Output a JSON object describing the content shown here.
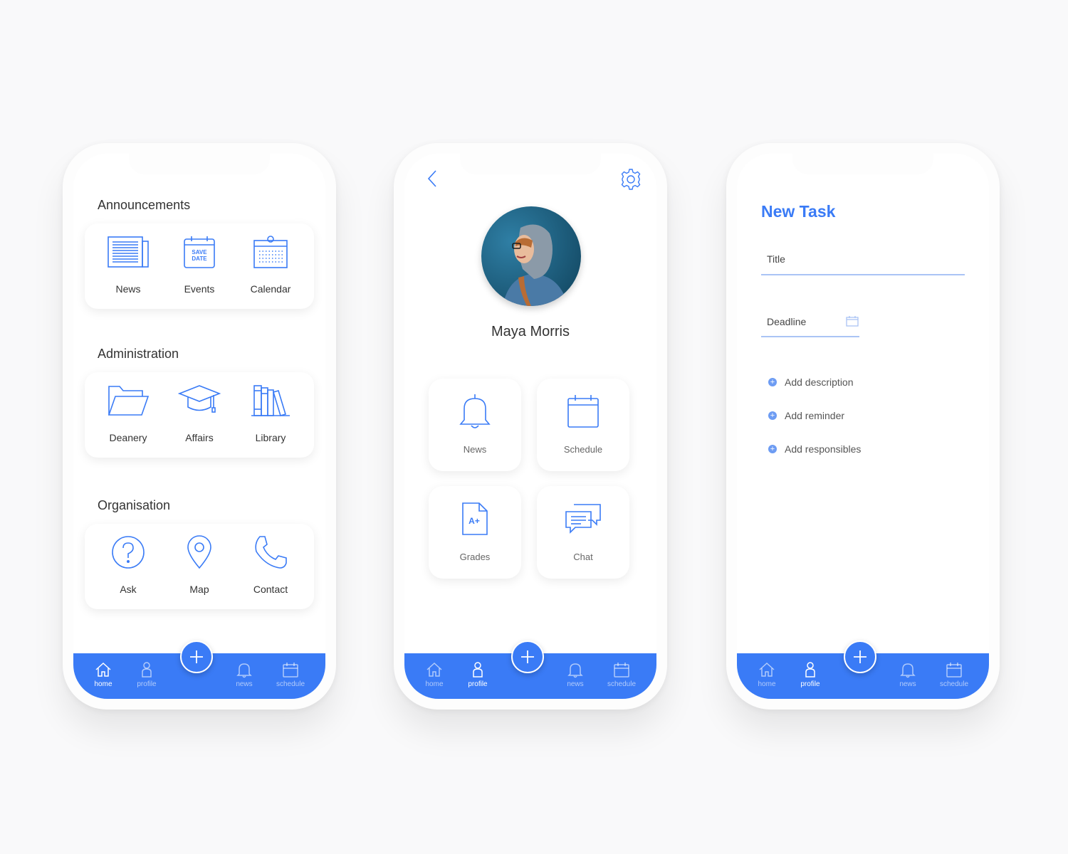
{
  "colors": {
    "accent": "#3a7bf6",
    "background": "#f9f9fa",
    "card": "#ffffff"
  },
  "home_screen": {
    "sections": [
      {
        "title": "Announcements",
        "items": [
          {
            "label": "News",
            "icon": "newspaper-icon"
          },
          {
            "label": "Events",
            "icon": "save-the-date-icon"
          },
          {
            "label": "Calendar",
            "icon": "calendar-icon"
          }
        ]
      },
      {
        "title": "Administration",
        "items": [
          {
            "label": "Deanery",
            "icon": "folder-icon"
          },
          {
            "label": "Affairs",
            "icon": "graduation-cap-icon"
          },
          {
            "label": "Library",
            "icon": "books-icon"
          }
        ]
      },
      {
        "title": "Organisation",
        "items": [
          {
            "label": "Ask",
            "icon": "question-icon"
          },
          {
            "label": "Map",
            "icon": "map-pin-icon"
          },
          {
            "label": "Contact",
            "icon": "phone-icon"
          }
        ]
      }
    ],
    "events_icon_text": [
      "SAVE",
      "DATE"
    ]
  },
  "profile_screen": {
    "user_name": "Maya Morris",
    "tiles": [
      {
        "label": "News",
        "icon": "bell-icon"
      },
      {
        "label": "Schedule",
        "icon": "calendar-icon"
      },
      {
        "label": "Grades",
        "icon": "grade-document-icon",
        "icon_text": "A+"
      },
      {
        "label": "Chat",
        "icon": "chat-bubbles-icon"
      }
    ]
  },
  "task_screen": {
    "title": "New Task",
    "title_field_label": "Title",
    "deadline_field_label": "Deadline",
    "add_actions": [
      "Add description",
      "Add reminder",
      "Add responsibles"
    ]
  },
  "tabbar": {
    "tabs": [
      {
        "label": "home",
        "icon": "home-icon"
      },
      {
        "label": "profile",
        "icon": "person-icon"
      },
      {
        "label": "news",
        "icon": "bell-icon"
      },
      {
        "label": "schedule",
        "icon": "calendar-icon"
      }
    ],
    "active_per_screen": [
      "home",
      "profile",
      "profile"
    ],
    "fab_icon": "plus-icon"
  }
}
